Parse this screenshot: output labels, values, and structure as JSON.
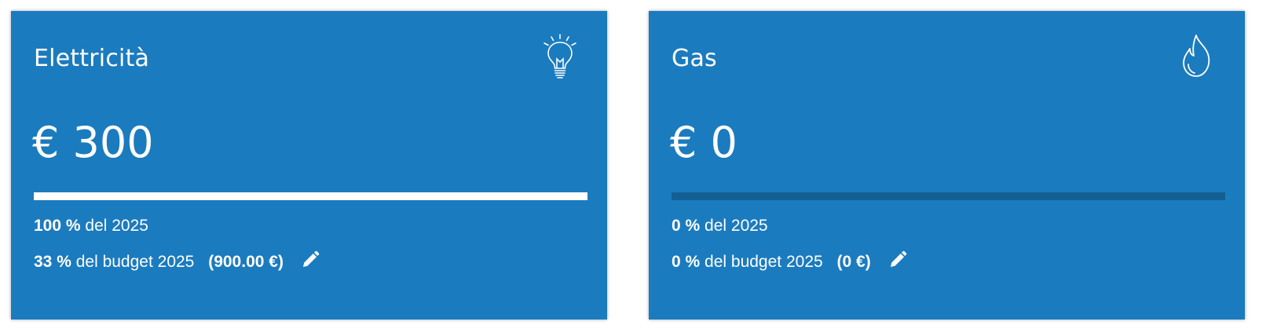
{
  "cards": [
    {
      "title": "Elettricità",
      "icon": "lightbulb-icon",
      "amount": "€ 300",
      "progress": 1.0,
      "year_percent": "100 %",
      "year_label": "del 2025",
      "budget_percent": "33 %",
      "budget_label": "del budget 2025",
      "budget_amount": "(900.00 €)"
    },
    {
      "title": "Gas",
      "icon": "flame-icon",
      "amount": "€ 0",
      "progress": 0.0,
      "year_percent": "0 %",
      "year_label": "del 2025",
      "budget_percent": "0 %",
      "budget_label": "del budget 2025",
      "budget_amount": "(0 €)"
    }
  ],
  "colors": {
    "card_background": "#1b7bbf",
    "progress_track": "#135f94",
    "progress_fill": "#ffffff",
    "text": "#ffffff"
  }
}
